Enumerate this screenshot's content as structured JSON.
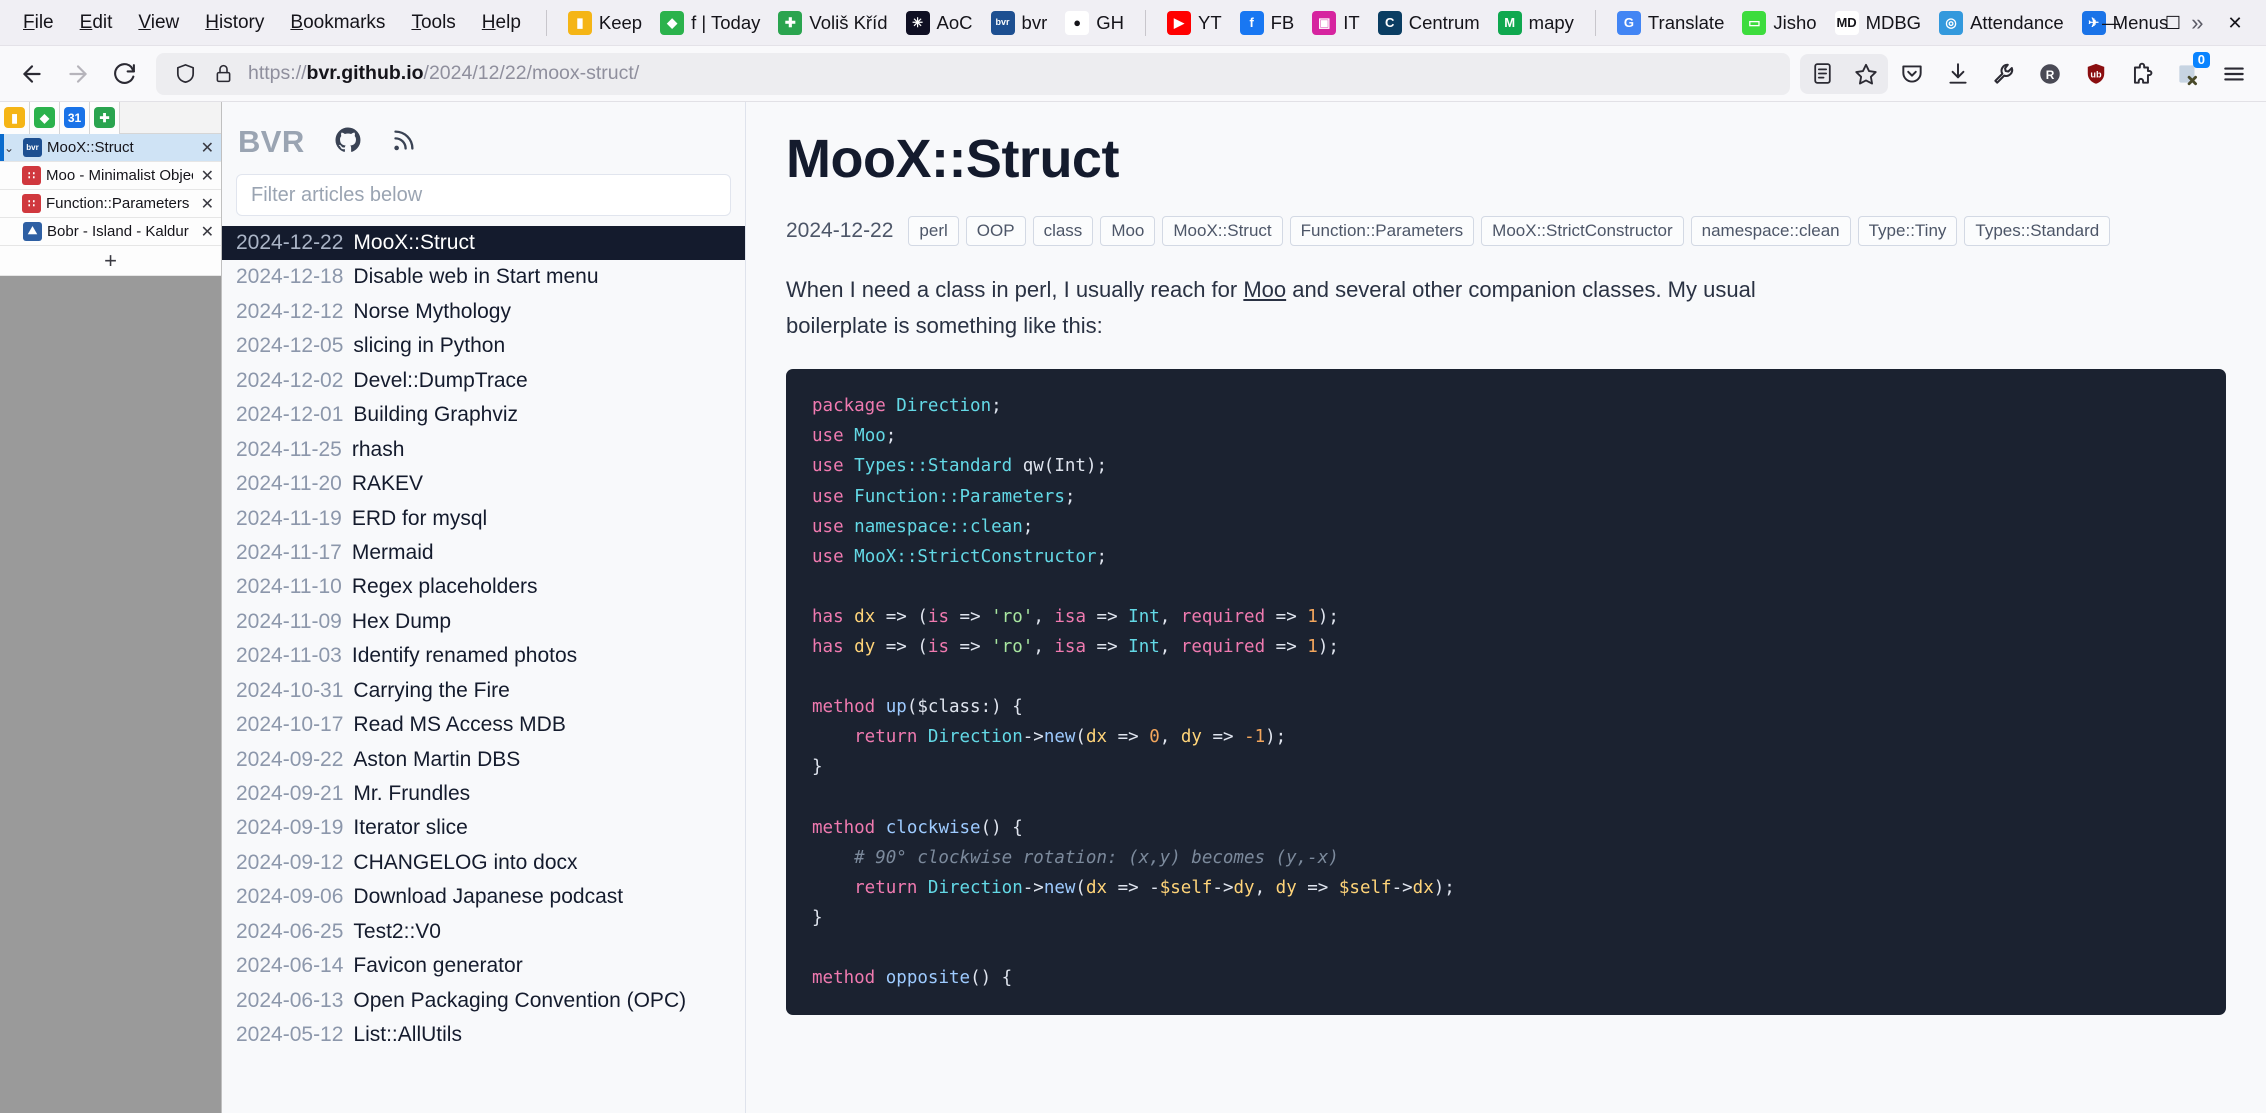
{
  "browser": {
    "menus": [
      "File",
      "Edit",
      "View",
      "History",
      "Bookmarks",
      "Tools",
      "Help"
    ],
    "bookmarks": [
      {
        "label": "Keep",
        "icon": "keep-icon",
        "color": "#f5b516",
        "glyph": "▮"
      },
      {
        "label": "f | Today",
        "icon": "feedly-icon",
        "color": "#2bb24c",
        "glyph": "◆"
      },
      {
        "label": "Voliš Kříd",
        "icon": "cross-icon",
        "color": "#2aa44f",
        "glyph": "✚"
      },
      {
        "label": "AoC",
        "icon": "advent-of-code-icon",
        "color": "#0f0f23",
        "glyph": "✳"
      },
      {
        "label": "bvr",
        "icon": "bvr-icon",
        "color": "#1d4f91",
        "glyph": "bvr"
      },
      {
        "label": "GH",
        "icon": "github-icon",
        "color": "#ffffff",
        "glyph": "●"
      },
      {
        "label": "YT",
        "icon": "youtube-icon",
        "color": "#ff0000",
        "glyph": "▶"
      },
      {
        "label": "FB",
        "icon": "facebook-icon",
        "color": "#1877f2",
        "glyph": "f"
      },
      {
        "label": "IT",
        "icon": "instagram-icon",
        "color": "#d6249f",
        "glyph": "▣"
      },
      {
        "label": "Centrum",
        "icon": "centrum-icon",
        "color": "#0a3d62",
        "glyph": "C"
      },
      {
        "label": "mapy",
        "icon": "mapy-icon",
        "color": "#0fa84f",
        "glyph": "M"
      },
      {
        "label": "Translate",
        "icon": "google-translate-icon",
        "color": "#4285f4",
        "glyph": "G"
      },
      {
        "label": "Jisho",
        "icon": "jisho-icon",
        "color": "#3ddc3d",
        "glyph": "▭"
      },
      {
        "label": "MDBG",
        "icon": "mdbg-icon",
        "color": "#ffffff",
        "glyph": "MD"
      },
      {
        "label": "Attendance",
        "icon": "attendance-icon",
        "color": "#3399dd",
        "glyph": "◎"
      },
      {
        "label": "Menus",
        "icon": "menus-icon",
        "color": "#1a73e8",
        "glyph": "✈"
      }
    ],
    "overflow_label": "»",
    "window": {
      "minimize": "—",
      "maximize": "☐",
      "close": "✕"
    },
    "nav": {
      "back": "←",
      "forward": "→",
      "reload": "⟳",
      "shield": "shield-icon",
      "lock": "lock-icon"
    },
    "url": {
      "scheme": "https://",
      "host": "bvr.github.io",
      "path": "/2024/12/22/moox-struct/"
    },
    "toolbar_right": [
      {
        "name": "reader-view-icon",
        "glyph": "☰"
      },
      {
        "name": "bookmark-star-icon",
        "glyph": "☆"
      },
      {
        "name": "pocket-icon",
        "glyph": "♥"
      },
      {
        "name": "downloads-icon",
        "glyph": "⬇"
      },
      {
        "name": "wrench-icon",
        "glyph": "ὒ7"
      },
      {
        "name": "r-circle-icon",
        "glyph": "R"
      },
      {
        "name": "ublock-origin-icon",
        "glyph": "●"
      },
      {
        "name": "extension-puzzle-icon",
        "glyph": "❖"
      },
      {
        "name": "tab-session-icon",
        "glyph": "▧",
        "badge": "0"
      },
      {
        "name": "app-menu-icon",
        "glyph": "≡"
      }
    ]
  },
  "tabsidebar": {
    "toolbar_icons": [
      {
        "name": "keep-sidebar-icon",
        "color": "#f5b516",
        "glyph": "▮"
      },
      {
        "name": "feedly-sidebar-icon",
        "color": "#2bb24c",
        "glyph": "◆"
      },
      {
        "name": "calendar-sidebar-icon",
        "color": "#1a73e8",
        "glyph": "31"
      },
      {
        "name": "cross-sidebar-icon",
        "color": "#2aa44f",
        "glyph": "✚"
      }
    ],
    "tabs": [
      {
        "label": "MooX::Struct",
        "favicon": "bvr-favicon",
        "color": "#1d4f91",
        "glyph": "bvr",
        "active": true,
        "child": false,
        "chevron": "⌄"
      },
      {
        "label": "Moo - Minimalist Object (",
        "favicon": "metacpan-favicon",
        "color": "#d0383e",
        "glyph": "∷",
        "active": false,
        "child": true,
        "chevron": ""
      },
      {
        "label": "Function::Parameters - de",
        "favicon": "metacpan-favicon",
        "color": "#d0383e",
        "glyph": "∷",
        "active": false,
        "child": true,
        "chevron": ""
      },
      {
        "label": "Bobr - Island - Kaldur pottur",
        "favicon": "bobr-favicon",
        "color": "#2e5fa3",
        "glyph": "⛰",
        "active": false,
        "child": false,
        "chevron": ""
      }
    ],
    "new_tab": "+",
    "close_glyph": "✕"
  },
  "sitepanel": {
    "brand": "BVR",
    "icons": [
      {
        "name": "github-icon"
      },
      {
        "name": "rss-icon"
      }
    ],
    "filter_placeholder": "Filter articles below",
    "filter_value": "",
    "articles": [
      {
        "date": "2024-12-22",
        "title": "MooX::Struct",
        "selected": true
      },
      {
        "date": "2024-12-18",
        "title": "Disable web in Start menu",
        "selected": false
      },
      {
        "date": "2024-12-12",
        "title": "Norse Mythology",
        "selected": false
      },
      {
        "date": "2024-12-05",
        "title": "slicing in Python",
        "selected": false
      },
      {
        "date": "2024-12-02",
        "title": "Devel::DumpTrace",
        "selected": false
      },
      {
        "date": "2024-12-01",
        "title": "Building Graphviz",
        "selected": false
      },
      {
        "date": "2024-11-25",
        "title": "rhash",
        "selected": false
      },
      {
        "date": "2024-11-20",
        "title": "RAKEV",
        "selected": false
      },
      {
        "date": "2024-11-19",
        "title": "ERD for mysql",
        "selected": false
      },
      {
        "date": "2024-11-17",
        "title": "Mermaid",
        "selected": false
      },
      {
        "date": "2024-11-10",
        "title": "Regex placeholders",
        "selected": false
      },
      {
        "date": "2024-11-09",
        "title": "Hex Dump",
        "selected": false
      },
      {
        "date": "2024-11-03",
        "title": "Identify renamed photos",
        "selected": false
      },
      {
        "date": "2024-10-31",
        "title": "Carrying the Fire",
        "selected": false
      },
      {
        "date": "2024-10-17",
        "title": "Read MS Access MDB",
        "selected": false
      },
      {
        "date": "2024-09-22",
        "title": "Aston Martin DBS",
        "selected": false
      },
      {
        "date": "2024-09-21",
        "title": "Mr. Frundles",
        "selected": false
      },
      {
        "date": "2024-09-19",
        "title": "Iterator slice",
        "selected": false
      },
      {
        "date": "2024-09-12",
        "title": "CHANGELOG into docx",
        "selected": false
      },
      {
        "date": "2024-09-06",
        "title": "Download Japanese podcast",
        "selected": false
      },
      {
        "date": "2024-06-25",
        "title": "Test2::V0",
        "selected": false
      },
      {
        "date": "2024-06-14",
        "title": "Favicon generator",
        "selected": false
      },
      {
        "date": "2024-06-13",
        "title": "Open Packaging Convention (OPC)",
        "selected": false
      },
      {
        "date": "2024-05-12",
        "title": "List::AllUtils",
        "selected": false
      }
    ]
  },
  "article": {
    "title": "MooX::Struct",
    "date": "2024-12-22",
    "tags": [
      "perl",
      "OOP",
      "class",
      "Moo",
      "MooX::Struct",
      "Function::Parameters",
      "MooX::StrictConstructor",
      "namespace::clean",
      "Type::Tiny",
      "Types::Standard"
    ],
    "intro_before": "When I need a class in perl, I usually reach for ",
    "intro_link": "Moo",
    "intro_after": " and several other companion classes. My usual boilerplate is something like this:",
    "code_lines": [
      [
        {
          "t": "package ",
          "c": "kw"
        },
        {
          "t": "Direction",
          "c": "mod"
        },
        {
          "t": ";",
          "c": "pl"
        }
      ],
      [
        {
          "t": "use ",
          "c": "kw"
        },
        {
          "t": "Moo",
          "c": "mod"
        },
        {
          "t": ";",
          "c": "pl"
        }
      ],
      [
        {
          "t": "use ",
          "c": "kw"
        },
        {
          "t": "Types::Standard",
          "c": "mod"
        },
        {
          "t": " qw(Int);",
          "c": "pl"
        }
      ],
      [
        {
          "t": "use ",
          "c": "kw"
        },
        {
          "t": "Function::Parameters",
          "c": "mod"
        },
        {
          "t": ";",
          "c": "pl"
        }
      ],
      [
        {
          "t": "use ",
          "c": "kw"
        },
        {
          "t": "namespace::clean",
          "c": "mod"
        },
        {
          "t": ";",
          "c": "pl"
        }
      ],
      [
        {
          "t": "use ",
          "c": "kw"
        },
        {
          "t": "MooX::StrictConstructor",
          "c": "mod"
        },
        {
          "t": ";",
          "c": "pl"
        }
      ],
      [],
      [
        {
          "t": "has ",
          "c": "kw"
        },
        {
          "t": "dx",
          "c": "var"
        },
        {
          "t": " => (",
          "c": "pl"
        },
        {
          "t": "is",
          "c": "kw"
        },
        {
          "t": " => ",
          "c": "pl"
        },
        {
          "t": "'ro'",
          "c": "str"
        },
        {
          "t": ", ",
          "c": "pl"
        },
        {
          "t": "isa",
          "c": "kw"
        },
        {
          "t": " => ",
          "c": "pl"
        },
        {
          "t": "Int",
          "c": "mod"
        },
        {
          "t": ", ",
          "c": "pl"
        },
        {
          "t": "required",
          "c": "kw"
        },
        {
          "t": " => ",
          "c": "pl"
        },
        {
          "t": "1",
          "c": "num"
        },
        {
          "t": ");",
          "c": "pl"
        }
      ],
      [
        {
          "t": "has ",
          "c": "kw"
        },
        {
          "t": "dy",
          "c": "var"
        },
        {
          "t": " => (",
          "c": "pl"
        },
        {
          "t": "is",
          "c": "kw"
        },
        {
          "t": " => ",
          "c": "pl"
        },
        {
          "t": "'ro'",
          "c": "str"
        },
        {
          "t": ", ",
          "c": "pl"
        },
        {
          "t": "isa",
          "c": "kw"
        },
        {
          "t": " => ",
          "c": "pl"
        },
        {
          "t": "Int",
          "c": "mod"
        },
        {
          "t": ", ",
          "c": "pl"
        },
        {
          "t": "required",
          "c": "kw"
        },
        {
          "t": " => ",
          "c": "pl"
        },
        {
          "t": "1",
          "c": "num"
        },
        {
          "t": ");",
          "c": "pl"
        }
      ],
      [],
      [
        {
          "t": "method ",
          "c": "kw"
        },
        {
          "t": "up",
          "c": "fn"
        },
        {
          "t": "($class:) {",
          "c": "pl"
        }
      ],
      [
        {
          "t": "    return ",
          "c": "kw"
        },
        {
          "t": "Direction",
          "c": "mod"
        },
        {
          "t": "->",
          "c": "pl"
        },
        {
          "t": "new",
          "c": "fn"
        },
        {
          "t": "(",
          "c": "pl"
        },
        {
          "t": "dx",
          "c": "var"
        },
        {
          "t": " => ",
          "c": "pl"
        },
        {
          "t": "0",
          "c": "num"
        },
        {
          "t": ", ",
          "c": "pl"
        },
        {
          "t": "dy",
          "c": "var"
        },
        {
          "t": " => ",
          "c": "pl"
        },
        {
          "t": "-1",
          "c": "num"
        },
        {
          "t": ");",
          "c": "pl"
        }
      ],
      [
        {
          "t": "}",
          "c": "pl"
        }
      ],
      [],
      [
        {
          "t": "method ",
          "c": "kw"
        },
        {
          "t": "clockwise",
          "c": "fn"
        },
        {
          "t": "() {",
          "c": "pl"
        }
      ],
      [
        {
          "t": "    # 90° clockwise rotation: (x,y) becomes (y,-x)",
          "c": "cmt"
        }
      ],
      [
        {
          "t": "    return ",
          "c": "kw"
        },
        {
          "t": "Direction",
          "c": "mod"
        },
        {
          "t": "->",
          "c": "pl"
        },
        {
          "t": "new",
          "c": "fn"
        },
        {
          "t": "(",
          "c": "pl"
        },
        {
          "t": "dx",
          "c": "var"
        },
        {
          "t": " => -",
          "c": "pl"
        },
        {
          "t": "$self",
          "c": "var"
        },
        {
          "t": "->",
          "c": "pl"
        },
        {
          "t": "dy",
          "c": "var"
        },
        {
          "t": ", ",
          "c": "pl"
        },
        {
          "t": "dy",
          "c": "var"
        },
        {
          "t": " => ",
          "c": "pl"
        },
        {
          "t": "$self",
          "c": "var"
        },
        {
          "t": "->",
          "c": "pl"
        },
        {
          "t": "dx",
          "c": "var"
        },
        {
          "t": ");",
          "c": "pl"
        }
      ],
      [
        {
          "t": "}",
          "c": "pl"
        }
      ],
      [],
      [
        {
          "t": "method ",
          "c": "kw"
        },
        {
          "t": "opposite",
          "c": "fn"
        },
        {
          "t": "() {",
          "c": "pl"
        }
      ]
    ]
  }
}
